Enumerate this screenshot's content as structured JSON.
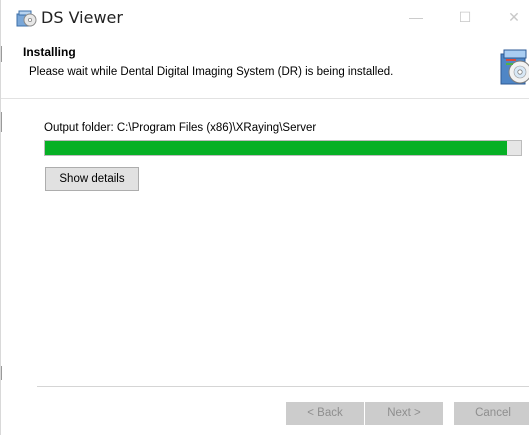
{
  "window": {
    "title": "DS Viewer",
    "minimize_glyph": "—",
    "maximize_glyph": "☐",
    "close_glyph": "✕",
    "app_icon": "installer-disc-icon"
  },
  "header": {
    "title": "Installing",
    "subtitle": "Please wait while Dental Digital Imaging System (DR) is being installed.",
    "icon": "installer-cd-icon"
  },
  "status": {
    "output_text": "Output folder: C:\\Program Files (x86)\\XRaying\\Server",
    "progress_percent": 97
  },
  "buttons": {
    "show_details": "Show details",
    "back": "< Back",
    "next": "Next >",
    "cancel": "Cancel"
  },
  "colors": {
    "progress_fill": "#06b025",
    "disabled_button_bg": "#cccccc",
    "disabled_button_text": "#8e8e8e"
  }
}
